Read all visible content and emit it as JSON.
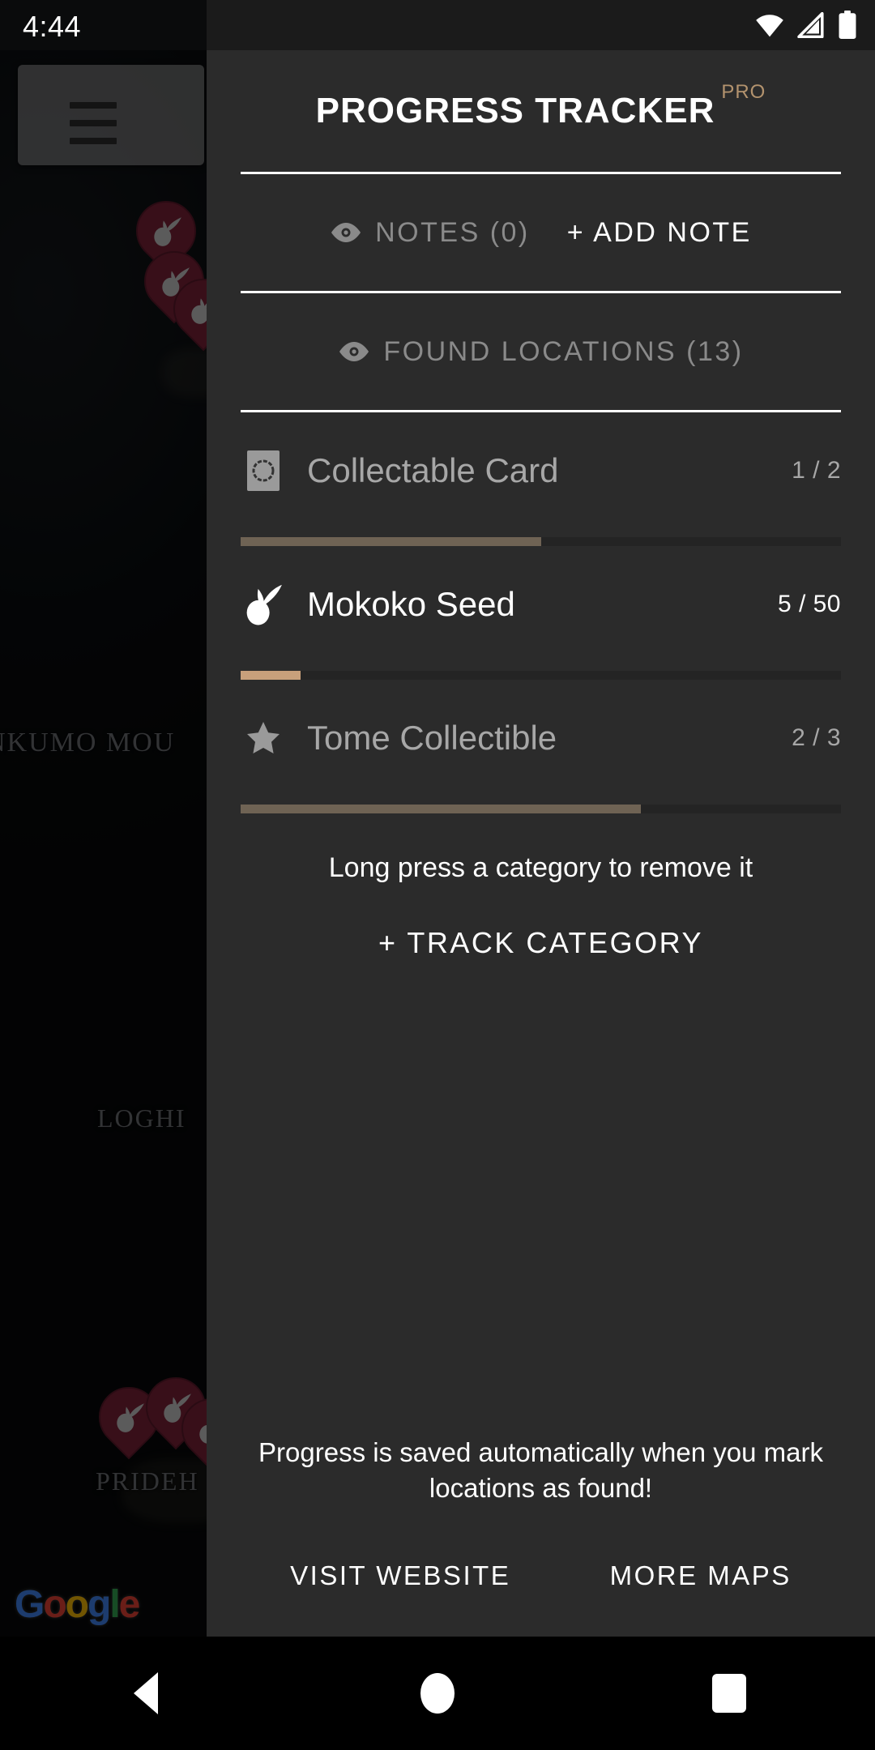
{
  "status_bar": {
    "time": "4:44",
    "icons": [
      "wifi-icon",
      "cellular-signal-icon",
      "battery-icon"
    ]
  },
  "map": {
    "menu_button_icon": "hamburger-menu-icon",
    "labels": [
      {
        "text": "NKUMO MOU",
        "name": "map-label-shinkumo-mountain"
      },
      {
        "text": "LOGHI",
        "name": "map-label-loghill"
      },
      {
        "text": "PRIDEH",
        "name": "map-label-prideholme"
      }
    ],
    "pin_icon": "mokoko-seed-pin-icon",
    "attribution": {
      "g1": "G",
      "o1": "o",
      "o2": "o",
      "g2": "g",
      "l1": "l",
      "e1": "e"
    }
  },
  "drawer": {
    "title": "PROGRESS TRACKER",
    "pro_badge": "PRO",
    "notes": {
      "eye_icon": "eye-icon",
      "label": "NOTES (0)",
      "add_label": "+ ADD NOTE"
    },
    "found_locations": {
      "eye_icon": "eye-icon",
      "label": "FOUND LOCATIONS (13)"
    },
    "categories": [
      {
        "name": "Collectable Card",
        "icon": "card-icon",
        "count": "1 / 2",
        "found": 1,
        "total": 2,
        "percent": 50,
        "highlighted": false
      },
      {
        "name": "Mokoko Seed",
        "icon": "mokoko-seed-icon",
        "count": "5 / 50",
        "found": 5,
        "total": 50,
        "percent": 10,
        "highlighted": true
      },
      {
        "name": "Tome Collectible",
        "icon": "star-icon",
        "count": "2 / 3",
        "found": 2,
        "total": 3,
        "percent": 66.7,
        "highlighted": false
      }
    ],
    "hint_long_press": "Long press a category to remove it",
    "track_category_label": "+ TRACK CATEGORY",
    "footer_note": "Progress is saved automatically when you mark locations as found!",
    "footer_links": [
      {
        "label": "VISIT WEBSITE",
        "name": "visit-website-link"
      },
      {
        "label": "MORE MAPS",
        "name": "more-maps-link"
      }
    ]
  },
  "nav_bar": {
    "back": "back-button",
    "home": "home-button",
    "recents": "recents-button"
  },
  "colors": {
    "accent_bronze": "#c8a07b",
    "accent_bronze_dim": "#6f6354",
    "drawer_bg": "#2b2b2b",
    "pin": "#7d2239",
    "pro_gold": "#b3936e"
  }
}
